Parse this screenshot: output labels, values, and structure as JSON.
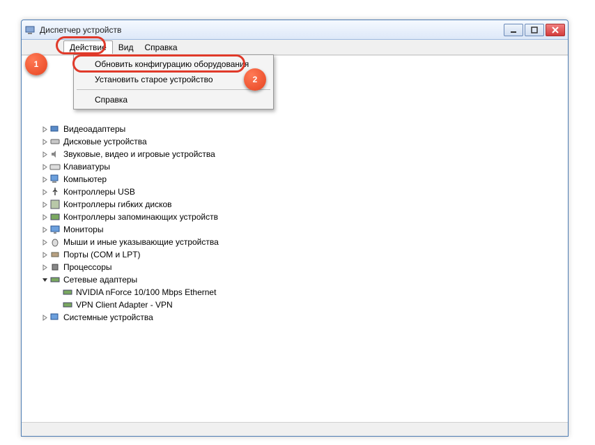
{
  "window": {
    "title": "Диспетчер устройств"
  },
  "menu": {
    "action": "Действие",
    "view": "Вид",
    "help": "Справка"
  },
  "dropdown": {
    "refresh": "Обновить конфигурацию оборудования",
    "legacy": "Установить старое устройство",
    "help": "Справка"
  },
  "tree": [
    {
      "label": "Видеоадаптеры",
      "icon": "display-adapter-icon"
    },
    {
      "label": "Дисковые устройства",
      "icon": "disk-icon"
    },
    {
      "label": "Звуковые, видео и игровые устройства",
      "icon": "sound-icon"
    },
    {
      "label": "Клавиатуры",
      "icon": "keyboard-icon"
    },
    {
      "label": "Компьютер",
      "icon": "computer-icon"
    },
    {
      "label": "Контроллеры USB",
      "icon": "usb-icon"
    },
    {
      "label": "Контроллеры гибких дисков",
      "icon": "floppy-controller-icon"
    },
    {
      "label": "Контроллеры запоминающих устройств",
      "icon": "storage-controller-icon"
    },
    {
      "label": "Мониторы",
      "icon": "monitor-icon"
    },
    {
      "label": "Мыши и иные указывающие устройства",
      "icon": "mouse-icon"
    },
    {
      "label": "Порты (COM и LPT)",
      "icon": "port-icon"
    },
    {
      "label": "Процессоры",
      "icon": "processor-icon"
    }
  ],
  "network": {
    "label": "Сетевые адаптеры",
    "children": [
      "NVIDIA nForce 10/100 Mbps Ethernet",
      "VPN Client Adapter - VPN"
    ]
  },
  "system_devices": "Системные устройства",
  "callouts": {
    "one": "1",
    "two": "2"
  }
}
